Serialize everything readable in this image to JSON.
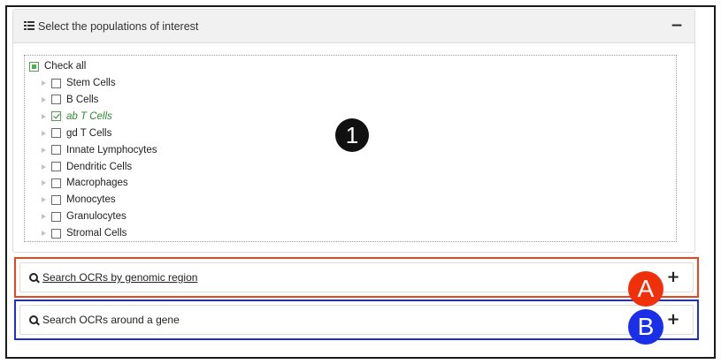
{
  "populations_panel": {
    "title": "Select the populations of interest",
    "icon": "list-icon",
    "collapse_symbol": "−",
    "check_all": {
      "label": "Check all",
      "state": "partial"
    },
    "nodes": [
      {
        "label": "Stem Cells",
        "checked": false
      },
      {
        "label": "B Cells",
        "checked": false
      },
      {
        "label": "ab T Cells",
        "checked": true
      },
      {
        "label": "gd T Cells",
        "checked": false
      },
      {
        "label": "Innate Lymphocytes",
        "checked": false
      },
      {
        "label": "Dendritic Cells",
        "checked": false
      },
      {
        "label": "Macrophages",
        "checked": false
      },
      {
        "label": "Monocytes",
        "checked": false
      },
      {
        "label": "Granulocytes",
        "checked": false
      },
      {
        "label": "Stromal Cells",
        "checked": false
      }
    ]
  },
  "search_region": {
    "label": "Search OCRs by genomic region",
    "expand_symbol": "+",
    "icon": "search-icon"
  },
  "search_gene": {
    "label": "Search OCRs around a gene",
    "expand_symbol": "+",
    "icon": "search-icon"
  },
  "annotations": {
    "marker_1": "1",
    "marker_a": "A",
    "marker_b": "B"
  },
  "colors": {
    "selected_green": "#2e8b2e",
    "annotation_red": "#f0300a",
    "annotation_blue": "#1a2fe8",
    "annotation_black": "#111111"
  }
}
